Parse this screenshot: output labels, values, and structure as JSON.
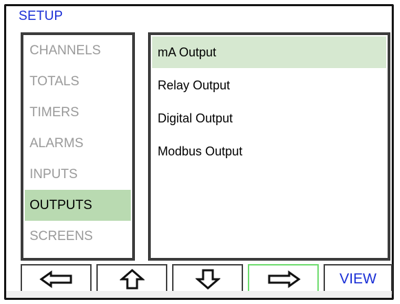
{
  "header": {
    "title": "SETUP"
  },
  "menu": {
    "items": [
      {
        "label": "CHANNELS",
        "active": false
      },
      {
        "label": "TOTALS",
        "active": false
      },
      {
        "label": "TIMERS",
        "active": false
      },
      {
        "label": "ALARMS",
        "active": false
      },
      {
        "label": "INPUTS",
        "active": false
      },
      {
        "label": "OUTPUTS",
        "active": true
      },
      {
        "label": "SCREENS",
        "active": false
      }
    ]
  },
  "submenu": {
    "items": [
      {
        "label": "mA Output",
        "active": true
      },
      {
        "label": "Relay Output",
        "active": false
      },
      {
        "label": "Digital Output",
        "active": false
      },
      {
        "label": "Modbus Output",
        "active": false
      }
    ]
  },
  "buttons": {
    "left_icon": "arrow-left-icon",
    "up_icon": "arrow-up-icon",
    "down_icon": "arrow-down-icon",
    "right_icon": "arrow-right-icon",
    "view_label": "VIEW"
  },
  "colors": {
    "title_blue": "#1a2fd6",
    "active_menu_bg": "#b9dab1",
    "active_sub_bg": "#d6e8d0",
    "highlight_border": "#6edc6e",
    "inactive_text": "#9a9a9a"
  }
}
